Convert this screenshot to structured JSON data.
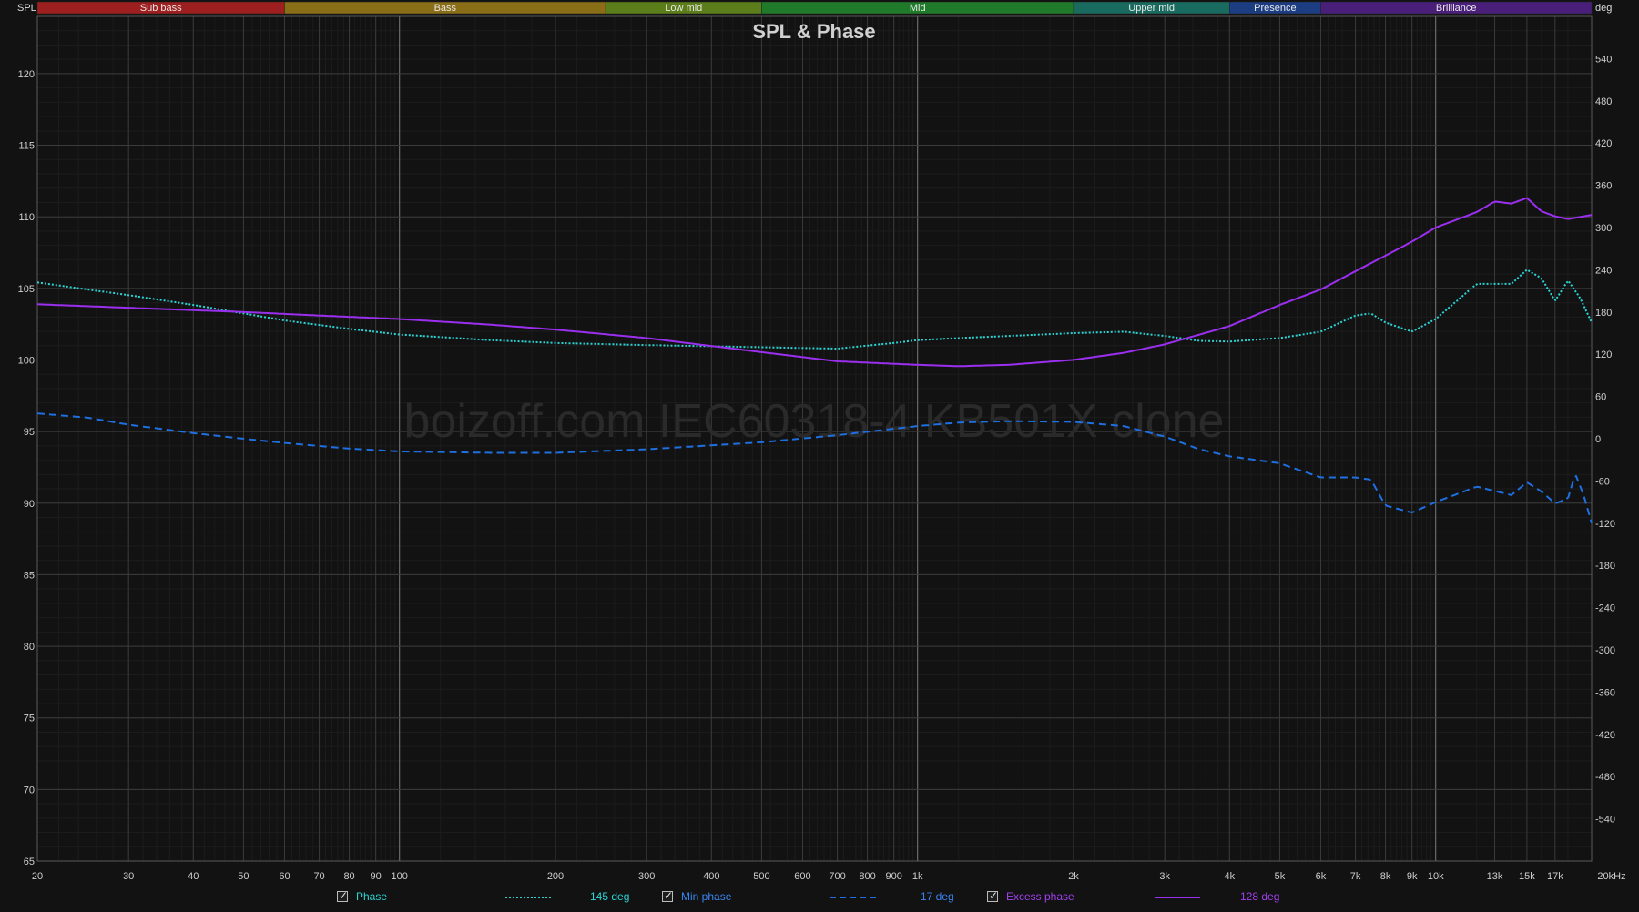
{
  "chart_data": {
    "type": "line",
    "title": "SPL & Phase",
    "watermark": "boizoff.com IEC60318-4 KB501X clone",
    "x_scale": "log",
    "xlim": [
      20,
      20000
    ],
    "ylabel_left": "SPL",
    "ylabel_right": "deg",
    "ylim_left": [
      65,
      124
    ],
    "ylim_right": [
      -600,
      600
    ],
    "grid": true,
    "y_ticks_left": [
      "65",
      "70",
      "75",
      "80",
      "85",
      "90",
      "95",
      "100",
      "105",
      "110",
      "115",
      "120"
    ],
    "y_ticks_right": [
      "540",
      "480",
      "420",
      "360",
      "300",
      "240",
      "180",
      "120",
      "60",
      "0",
      "-60",
      "-120",
      "-180",
      "-240",
      "-300",
      "-360",
      "-420",
      "-480",
      "-540"
    ],
    "x_ticks": [
      {
        "f": 20,
        "label": "20"
      },
      {
        "f": 30,
        "label": "30"
      },
      {
        "f": 40,
        "label": "40"
      },
      {
        "f": 50,
        "label": "50"
      },
      {
        "f": 60,
        "label": "60"
      },
      {
        "f": 70,
        "label": "70"
      },
      {
        "f": 80,
        "label": "80"
      },
      {
        "f": 90,
        "label": "90"
      },
      {
        "f": 100,
        "label": "100"
      },
      {
        "f": 200,
        "label": "200"
      },
      {
        "f": 300,
        "label": "300"
      },
      {
        "f": 400,
        "label": "400"
      },
      {
        "f": 500,
        "label": "500"
      },
      {
        "f": 600,
        "label": "600"
      },
      {
        "f": 700,
        "label": "700"
      },
      {
        "f": 800,
        "label": "800"
      },
      {
        "f": 900,
        "label": "900"
      },
      {
        "f": 1000,
        "label": "1k"
      },
      {
        "f": 2000,
        "label": "2k"
      },
      {
        "f": 3000,
        "label": "3k"
      },
      {
        "f": 4000,
        "label": "4k"
      },
      {
        "f": 5000,
        "label": "5k"
      },
      {
        "f": 6000,
        "label": "6k"
      },
      {
        "f": 7000,
        "label": "7k"
      },
      {
        "f": 8000,
        "label": "8k"
      },
      {
        "f": 9000,
        "label": "9k"
      },
      {
        "f": 10000,
        "label": "10k"
      },
      {
        "f": 13000,
        "label": "13k"
      },
      {
        "f": 15000,
        "label": "15k"
      },
      {
        "f": 17000,
        "label": "17k"
      },
      {
        "f": 20000,
        "label": "20kHz"
      }
    ],
    "bands": [
      {
        "name": "Sub bass",
        "from": 20,
        "to": 60,
        "color": "#9e1f1f"
      },
      {
        "name": "Bass",
        "from": 60,
        "to": 250,
        "color": "#8a6d17"
      },
      {
        "name": "Low mid",
        "from": 250,
        "to": 500,
        "color": "#5b7d1a"
      },
      {
        "name": "Mid",
        "from": 500,
        "to": 2000,
        "color": "#1f7a2a"
      },
      {
        "name": "Upper mid",
        "from": 2000,
        "to": 4000,
        "color": "#1a6b5f"
      },
      {
        "name": "Presence",
        "from": 4000,
        "to": 6000,
        "color": "#1c3d82"
      },
      {
        "name": "Brilliance",
        "from": 6000,
        "to": 20000,
        "color": "#4a1f7a"
      }
    ],
    "series": [
      {
        "name": "Phase",
        "value": "145 deg",
        "axis": "right",
        "color": "#2ad4d4",
        "style": "dotted",
        "x": [
          20,
          25,
          30,
          40,
          50,
          60,
          80,
          100,
          150,
          200,
          300,
          500,
          700,
          900,
          1000,
          1200,
          1500,
          2000,
          2500,
          3000,
          3500,
          4000,
          5000,
          6000,
          7000,
          7500,
          8000,
          9000,
          10000,
          12000,
          14000,
          15000,
          16000,
          17000,
          18000,
          19000,
          20000
        ],
        "y": [
          222,
          212,
          204,
          190,
          178,
          168,
          156,
          148,
          140,
          136,
          133,
          130,
          128,
          136,
          140,
          143,
          146,
          150,
          152,
          146,
          139,
          138,
          143,
          152,
          175,
          178,
          165,
          152,
          170,
          220,
          220,
          240,
          228,
          196,
          225,
          200,
          165
        ]
      },
      {
        "name": "Min phase",
        "value": "17 deg",
        "axis": "right",
        "color": "#1e6fe0",
        "style": "dashed",
        "x": [
          20,
          25,
          30,
          40,
          50,
          60,
          80,
          100,
          150,
          200,
          300,
          500,
          700,
          1000,
          1200,
          1500,
          2000,
          2500,
          3000,
          3500,
          4000,
          5000,
          6000,
          7000,
          7500,
          8000,
          9000,
          10000,
          12000,
          14000,
          15000,
          16000,
          17000,
          18000,
          18600,
          19300,
          20000
        ],
        "y": [
          36,
          30,
          20,
          8,
          0,
          -6,
          -14,
          -18,
          -20,
          -20,
          -15,
          -5,
          5,
          18,
          23,
          25,
          24,
          18,
          3,
          -15,
          -25,
          -35,
          -55,
          -55,
          -58,
          -95,
          -105,
          -90,
          -68,
          -80,
          -62,
          -75,
          -92,
          -85,
          -50,
          -80,
          -120
        ]
      },
      {
        "name": "Excess phase",
        "value": "128 deg",
        "axis": "right",
        "color": "#9b2ff0",
        "style": "solid",
        "x": [
          20,
          30,
          50,
          70,
          100,
          150,
          200,
          300,
          500,
          700,
          1000,
          1200,
          1500,
          2000,
          2500,
          3000,
          4000,
          5000,
          6000,
          7000,
          8000,
          9000,
          10000,
          12000,
          13000,
          14000,
          15000,
          16000,
          17000,
          18000,
          20000
        ],
        "y": [
          191,
          186,
          180,
          175,
          170,
          162,
          155,
          143,
          123,
          110,
          105,
          103,
          105,
          112,
          122,
          134,
          160,
          190,
          212,
          238,
          260,
          280,
          300,
          322,
          337,
          334,
          342,
          323,
          316,
          312,
          318
        ]
      }
    ]
  },
  "legend": [
    {
      "label": "Phase",
      "value": "145 deg"
    },
    {
      "label": "Min phase",
      "value": "17 deg"
    },
    {
      "label": "Excess phase",
      "value": "128 deg"
    }
  ]
}
